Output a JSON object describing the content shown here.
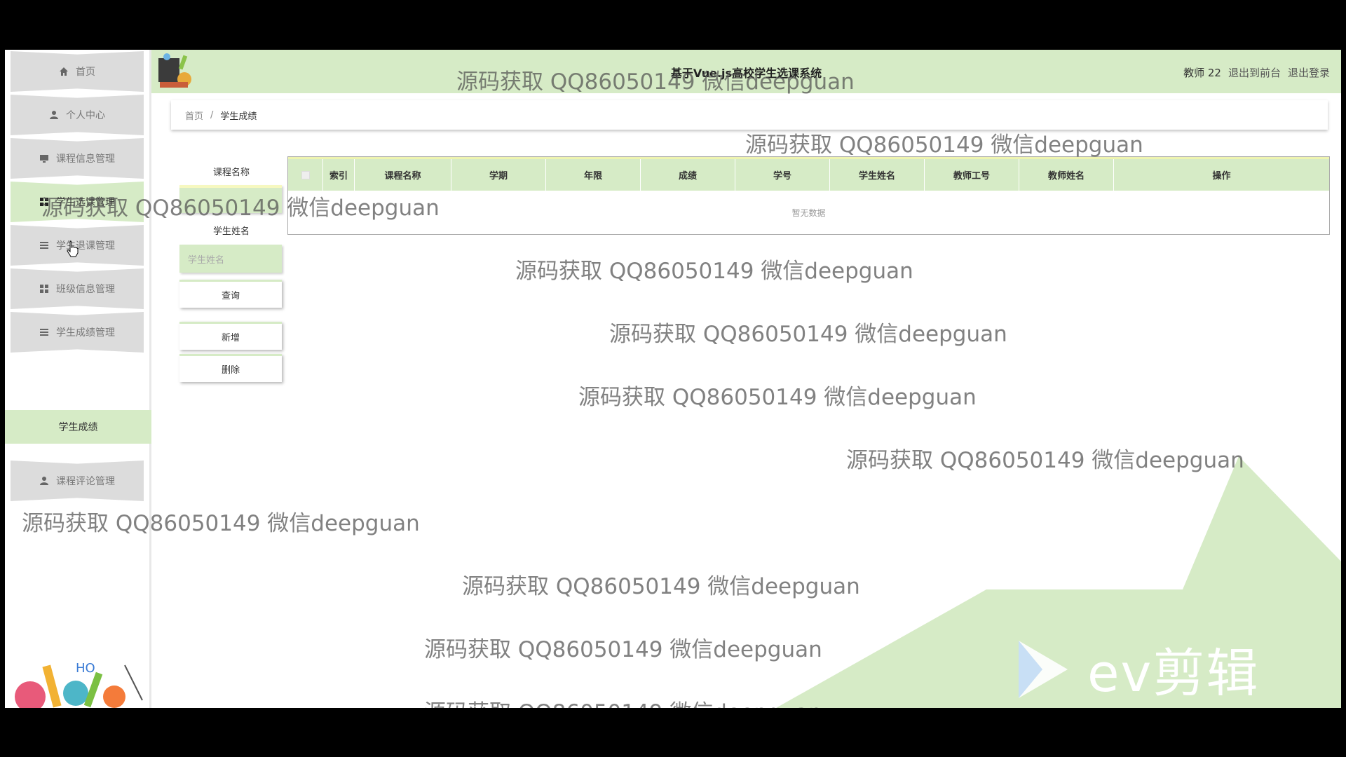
{
  "sidebar": {
    "items": [
      {
        "label": "首页",
        "icon": "home-icon"
      },
      {
        "label": "个人中心",
        "icon": "user-icon"
      },
      {
        "label": "课程信息管理",
        "icon": "monitor-icon"
      },
      {
        "label": "学生选课管理",
        "icon": "grid-icon"
      },
      {
        "label": "学生退课管理",
        "icon": "list-icon"
      },
      {
        "label": "班级信息管理",
        "icon": "grid-icon"
      },
      {
        "label": "学生成绩管理",
        "icon": "list-icon"
      },
      {
        "label": "课程评论管理",
        "icon": "user-icon"
      }
    ],
    "sub_item": "学生成绩"
  },
  "header": {
    "title": "基于Vue.js高校学生选课系统",
    "user": "教师 22",
    "front_link": "退出到前台",
    "logout_link": "退出登录"
  },
  "breadcrumb": {
    "home": "首页",
    "separator": "/",
    "current": "学生成绩"
  },
  "search": {
    "course_label": "课程名称",
    "student_label": "学生姓名",
    "student_placeholder": "学生姓名",
    "query_button": "查询",
    "add_button": "新增",
    "delete_button": "删除"
  },
  "table": {
    "columns": [
      "索引",
      "课程名称",
      "学期",
      "年限",
      "成绩",
      "学号",
      "学生姓名",
      "教师工号",
      "教师姓名",
      "操作"
    ],
    "empty_text": "暂无数据"
  },
  "watermark": {
    "text": "源码获取 QQ86050149 微信deepguan"
  },
  "overlay": {
    "ev_text": "ev剪辑"
  },
  "colors": {
    "accent_green": "#d6ebc6",
    "sidebar_gray": "#dcdcdc"
  }
}
